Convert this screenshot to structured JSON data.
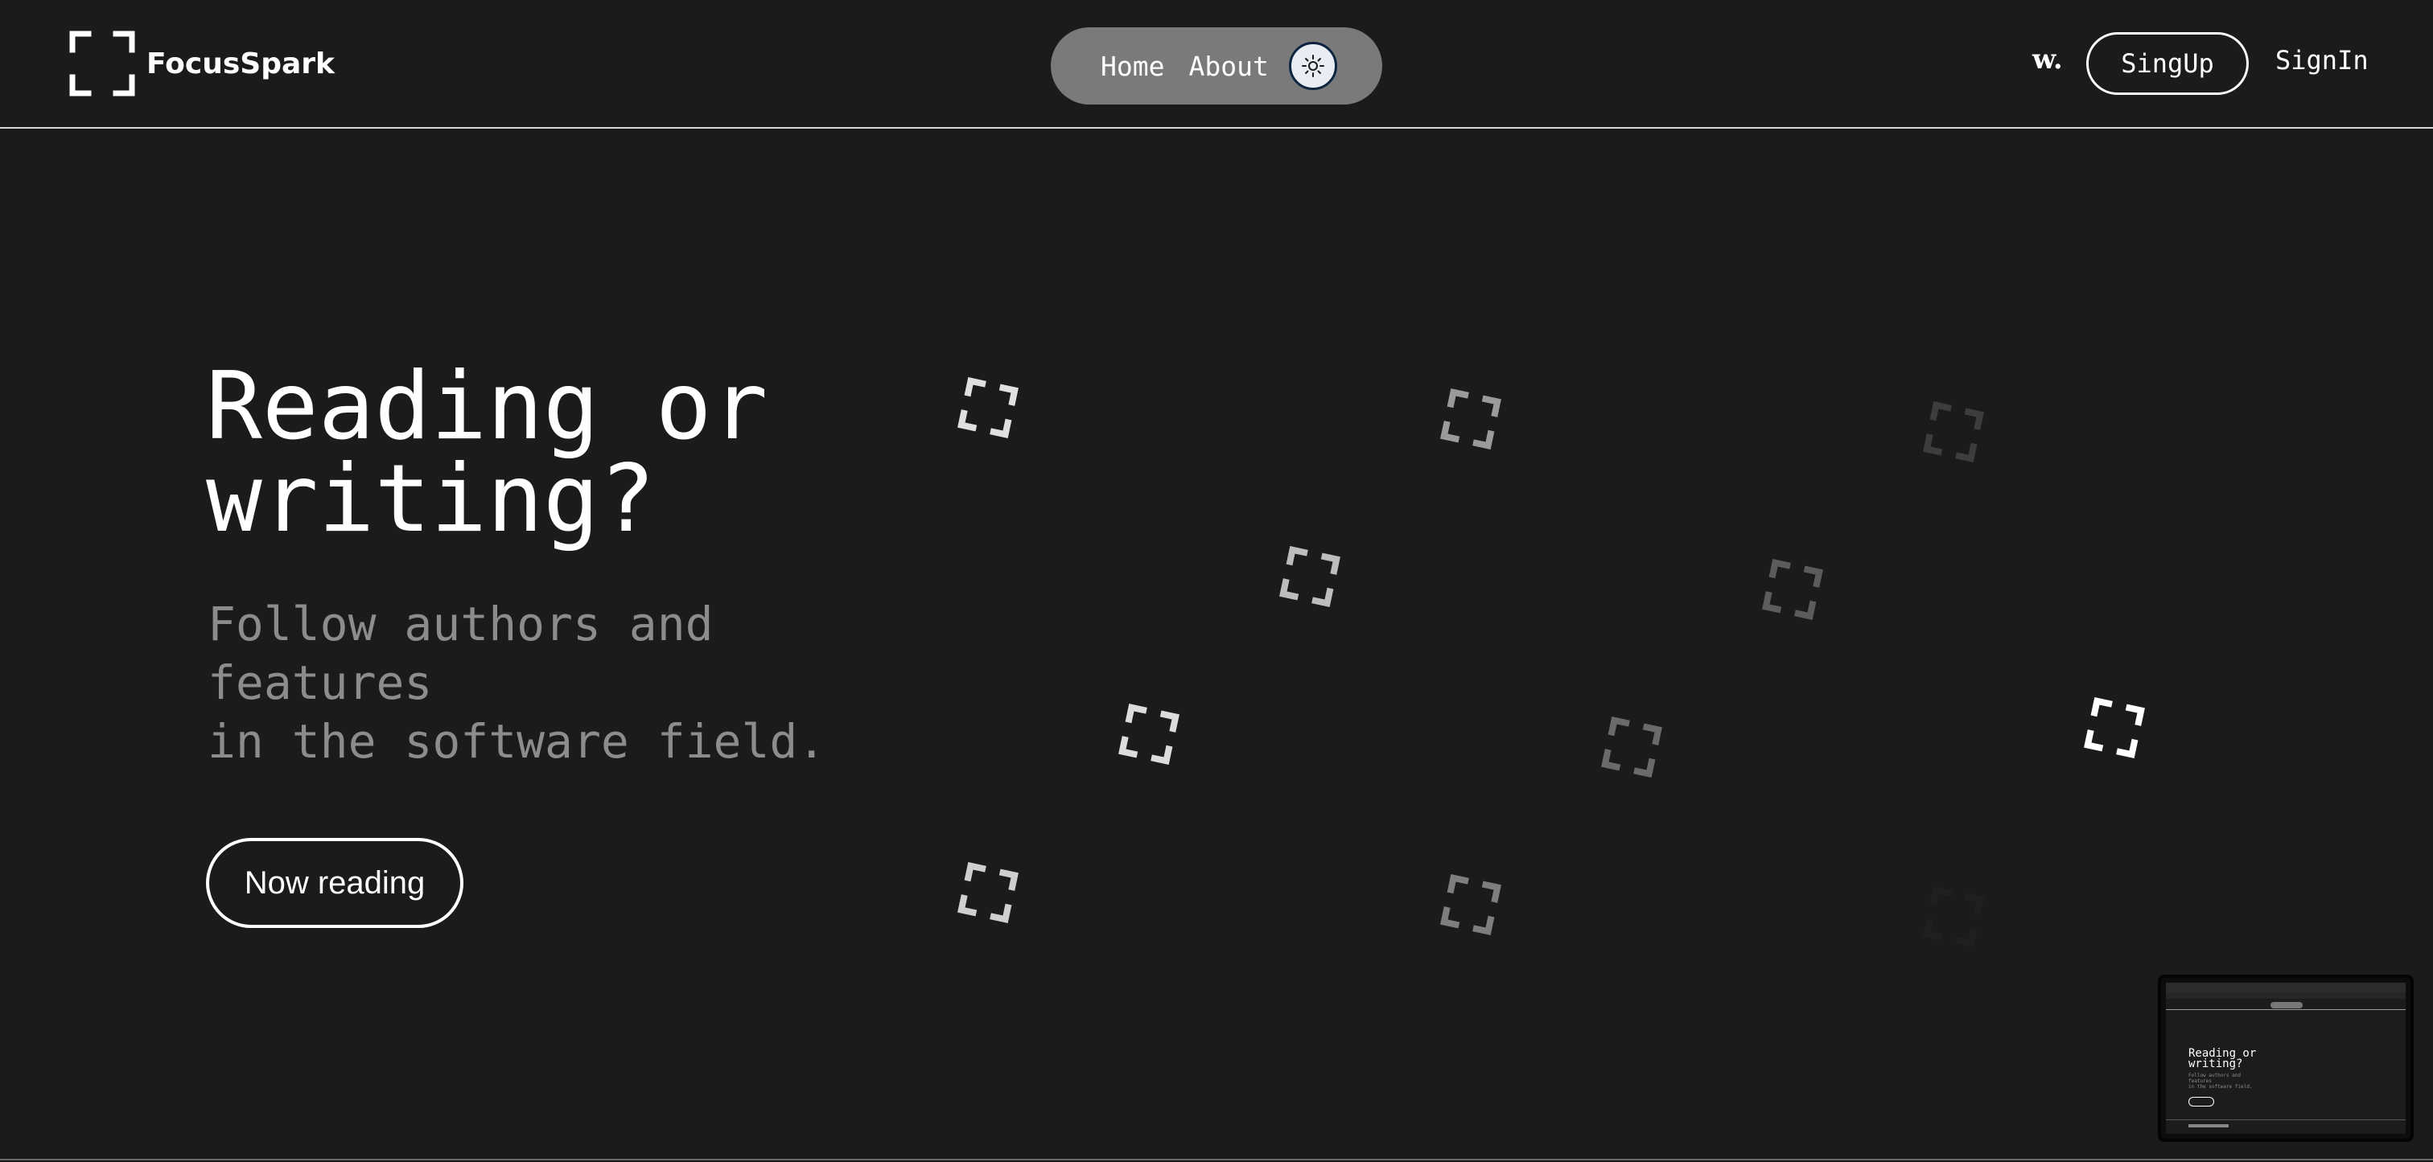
{
  "header": {
    "brand": "FocusSpark",
    "nav": {
      "home_label": "Home",
      "about_label": "About"
    },
    "w_mark": "w.",
    "signup_label": "SingUp",
    "signin_label": "SignIn"
  },
  "hero": {
    "title": "Reading or\nwriting?",
    "subtitle": "Follow authors and\nfeatures\nin the software field.",
    "cta_label": "Now reading"
  },
  "preview": {
    "title": "Reading or\nwriting?",
    "subtitle": "Follow authors and\nfeatures\nin the software field."
  },
  "colors": {
    "background": "#1b1b1b",
    "nav_pill": "#7a7a7a",
    "subtitle_text": "#8c8c8c",
    "toggle_border": "#0e2440"
  },
  "icons": {
    "logo": "focus-bracket-icon",
    "theme_toggle": "sun-icon",
    "decoration": "focus-bracket-icon"
  }
}
